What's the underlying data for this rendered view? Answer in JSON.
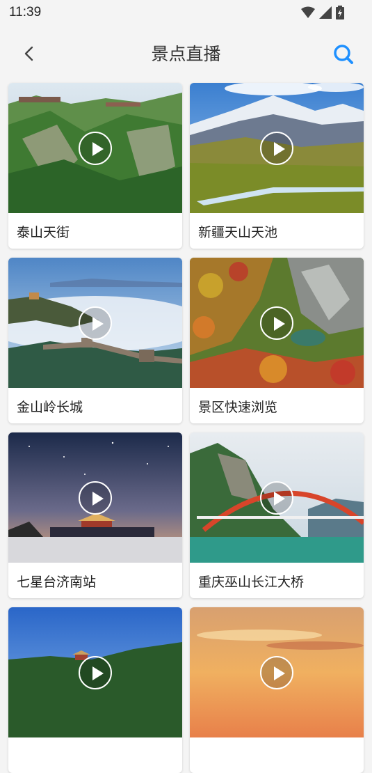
{
  "status": {
    "time": "11:39"
  },
  "nav": {
    "title": "景点直播"
  },
  "cards": [
    {
      "title": "泰山天街",
      "scene": "mountain-forest"
    },
    {
      "title": "新疆天山天池",
      "scene": "snow-mountain-grassland"
    },
    {
      "title": "金山岭长城",
      "scene": "great-wall-sea-of-clouds"
    },
    {
      "title": "景区快速浏览",
      "scene": "autumn-gorge"
    },
    {
      "title": "七星台济南站",
      "scene": "night-sky-pavilion"
    },
    {
      "title": "重庆巫山长江大桥",
      "scene": "arch-bridge-river"
    },
    {
      "title": "",
      "scene": "pavilion-blue-sky"
    },
    {
      "title": "",
      "scene": "sunset-clouds"
    }
  ]
}
